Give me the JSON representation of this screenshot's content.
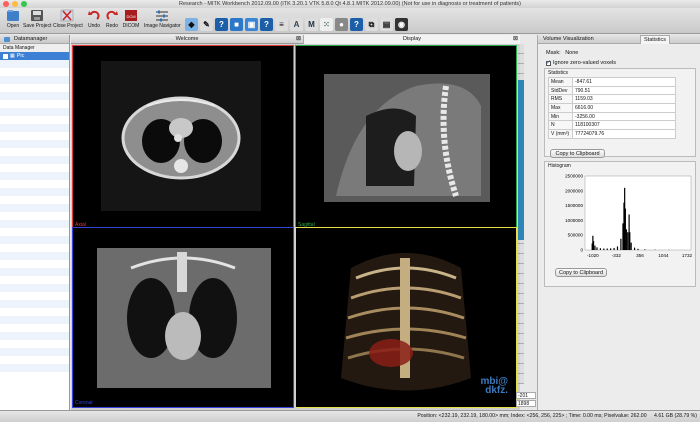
{
  "window": {
    "title": "Research - MITK Workbench 2012.09.00 (ITK 3.20.1  VTK 5.8.0 Qt 4.8.1 MITK 2012.09.00) (Not for use in diagnosis or treatment of patients)"
  },
  "toolbar": {
    "open": "Open",
    "save_project": "Save Project",
    "close_project": "Close Project",
    "undo": "Undo",
    "redo": "Redo",
    "dicom": "DICOM",
    "image_navigator": "Image Navigator"
  },
  "data_manager": {
    "tab": "Datamanager",
    "header": "Data Manager",
    "item": "Pic"
  },
  "center": {
    "tabs": [
      "Welcome",
      "Display"
    ],
    "views": {
      "axial_label": "Axial",
      "sagittal_label": "Sagittal",
      "coronal_label": "Coronal",
      "logo_line1": "mbi@",
      "logo_line2": "dkfz."
    },
    "level": "-201",
    "window": "1898",
    "colors": {
      "axial": "#e23b3b",
      "sagittal": "#2ea84a",
      "coronal": "#3544d8",
      "three_d": "#e6df4a"
    }
  },
  "right_panel": {
    "tabs": [
      "Volume Visualization",
      "Statistics"
    ],
    "mask_label": "Mask:",
    "mask_value": "None",
    "ignore_zero": "Ignore zero-valued voxels",
    "statistics_title": "Statistics",
    "stats": [
      {
        "key": "Mean",
        "value": "-847.61"
      },
      {
        "key": "StdDev",
        "value": "790.51"
      },
      {
        "key": "RMS",
        "value": "1159.03"
      },
      {
        "key": "Max",
        "value": "6616.00"
      },
      {
        "key": "Min",
        "value": "-3256.00"
      },
      {
        "key": "N",
        "value": "118100307"
      },
      {
        "key": "V (mm³)",
        "value": "77724079.76"
      }
    ],
    "copy_label": "Copy to Clipboard",
    "histogram_title": "Histogram",
    "histogram_copy_label": "Copy to Clipboard"
  },
  "chart_data": {
    "type": "histogram",
    "xlabel": "",
    "ylabel": "",
    "y_ticks": [
      "2500000",
      "2000000",
      "1500000",
      "1000000",
      "500000",
      "0"
    ],
    "x_ticks": [
      "-1020",
      "-332",
      "356",
      "1044",
      "1732"
    ],
    "ylim": [
      0,
      2500000
    ],
    "xlim": [
      -1250,
      1850
    ],
    "bins": [
      {
        "x": -1040,
        "y": 220000
      },
      {
        "x": -1020,
        "y": 480000
      },
      {
        "x": -1000,
        "y": 300000
      },
      {
        "x": -960,
        "y": 150000
      },
      {
        "x": -900,
        "y": 90000
      },
      {
        "x": -800,
        "y": 60000
      },
      {
        "x": -700,
        "y": 50000
      },
      {
        "x": -600,
        "y": 50000
      },
      {
        "x": -500,
        "y": 55000
      },
      {
        "x": -400,
        "y": 70000
      },
      {
        "x": -300,
        "y": 120000
      },
      {
        "x": -200,
        "y": 380000
      },
      {
        "x": -140,
        "y": 900000
      },
      {
        "x": -110,
        "y": 1600000
      },
      {
        "x": -90,
        "y": 2100000
      },
      {
        "x": -70,
        "y": 1400000
      },
      {
        "x": -40,
        "y": 700000
      },
      {
        "x": 0,
        "y": 600000
      },
      {
        "x": 40,
        "y": 1200000
      },
      {
        "x": 60,
        "y": 600000
      },
      {
        "x": 100,
        "y": 250000
      },
      {
        "x": 200,
        "y": 80000
      },
      {
        "x": 300,
        "y": 40000
      },
      {
        "x": 500,
        "y": 20000
      },
      {
        "x": 800,
        "y": 10000
      },
      {
        "x": 1200,
        "y": 5000
      }
    ],
    "bar_color": "#000000"
  },
  "status": {
    "text": "Position: <232.19, 232.19, 180.00> mm; Index: <256, 256, 225> ; Time: 0.00 ms; Pixelvalue: 262.00",
    "memory": "4.61 GB (28.79 %)"
  }
}
